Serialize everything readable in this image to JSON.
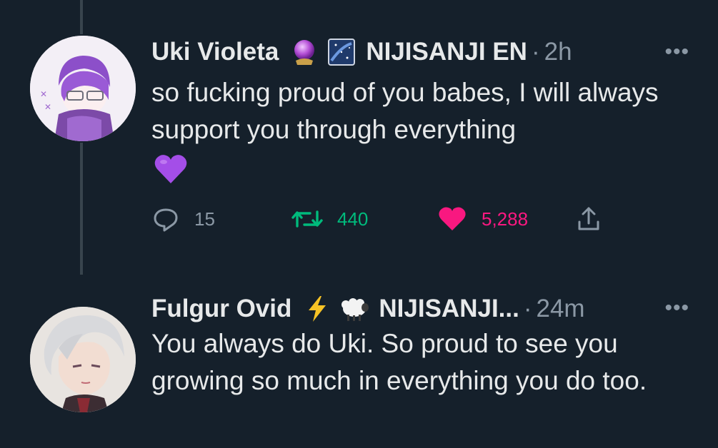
{
  "colors": {
    "background": "#15202b",
    "text": "#e7e9ea",
    "muted": "#8b98a5",
    "retweet": "#00ba7c",
    "like": "#f91880",
    "thread_line": "#38444d"
  },
  "tweets": [
    {
      "name": "Uki Violeta",
      "badge_icons": [
        "crystal-ball-emoji",
        "starry-night-emoji"
      ],
      "affiliation": "NIJISANJI EN",
      "separator": "·",
      "time": "2h",
      "more": "•••",
      "text": "so fucking proud of you babes, I will always support you through everything",
      "trailing_emoji": "purple-heart-emoji",
      "stats": {
        "replies": "15",
        "retweets": "440",
        "likes": "5,288",
        "liked": true
      }
    },
    {
      "name": "Fulgur Ovid",
      "badge_icons": [
        "lightning-emoji",
        "sheep-emoji"
      ],
      "affiliation": "NIJISANJI...",
      "separator": "·",
      "time": "24m",
      "more": "•••",
      "text": "You always do Uki. So proud to see you growing so much in everything you do too."
    }
  ]
}
